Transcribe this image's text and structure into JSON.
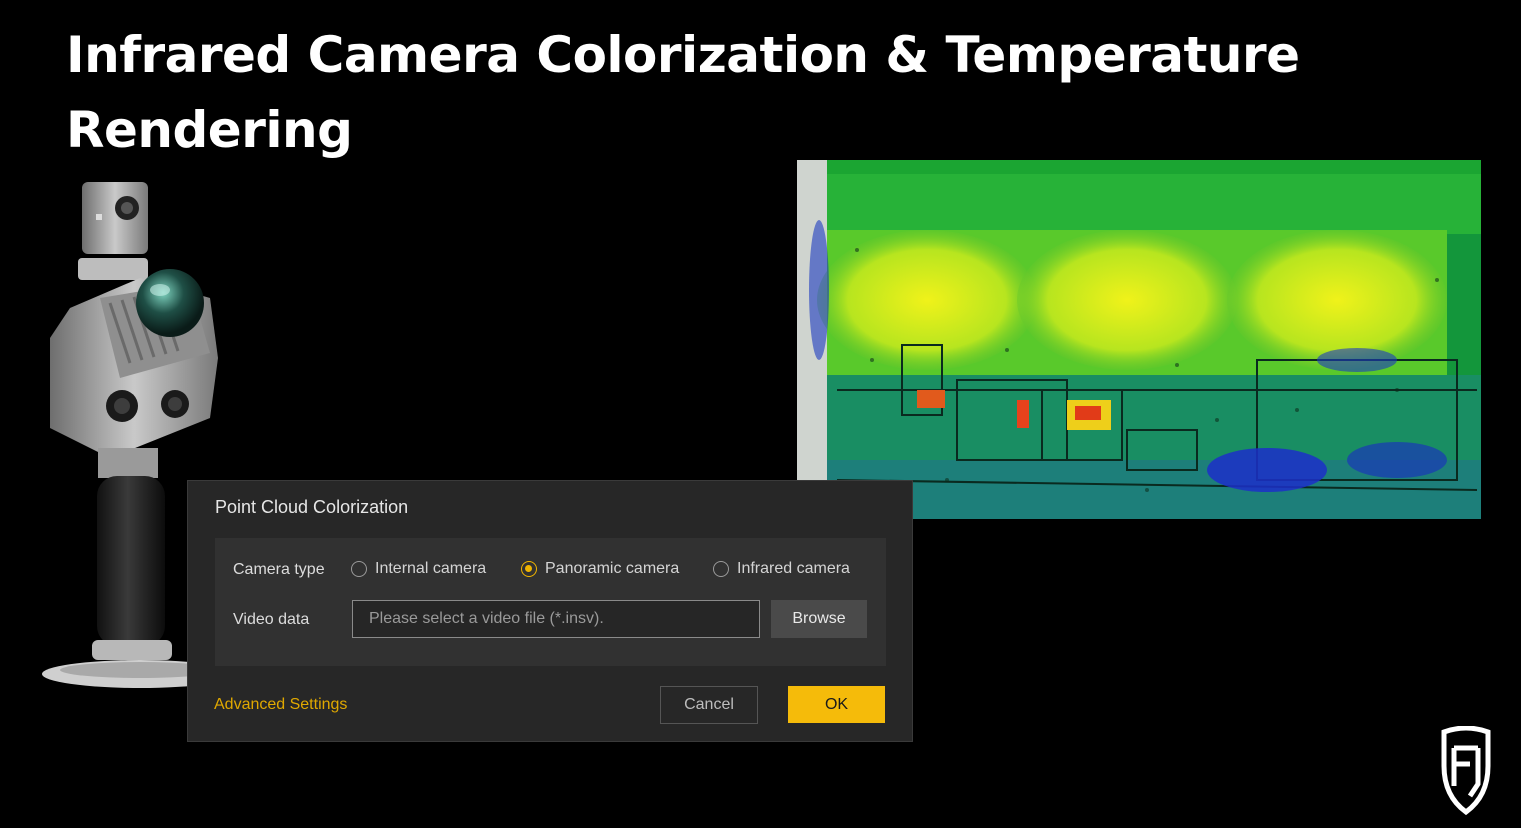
{
  "slide": {
    "title_line1": "Infrared Camera Colorization & Temperature",
    "title_line2": "Rendering"
  },
  "dialog": {
    "title": "Point Cloud Colorization",
    "camera_type_label": "Camera type",
    "camera_options": [
      {
        "label": "Internal camera",
        "selected": false
      },
      {
        "label": "Panoramic camera",
        "selected": true
      },
      {
        "label": "Infrared camera",
        "selected": false
      }
    ],
    "video_data_label": "Video data",
    "video_placeholder": "Please select a video file (*.insv).",
    "browse_label": "Browse",
    "advanced_settings_label": "Advanced Settings",
    "cancel_label": "Cancel",
    "ok_label": "OK"
  },
  "colors": {
    "accent": "#f5bb0a",
    "background": "#000000",
    "dialog_bg": "#272727"
  },
  "icons": {
    "scanner_device": "handheld-lidar-scanner-image",
    "thermal_view": "thermal-point-cloud-image",
    "brand_logo": "shield-logo-icon"
  }
}
